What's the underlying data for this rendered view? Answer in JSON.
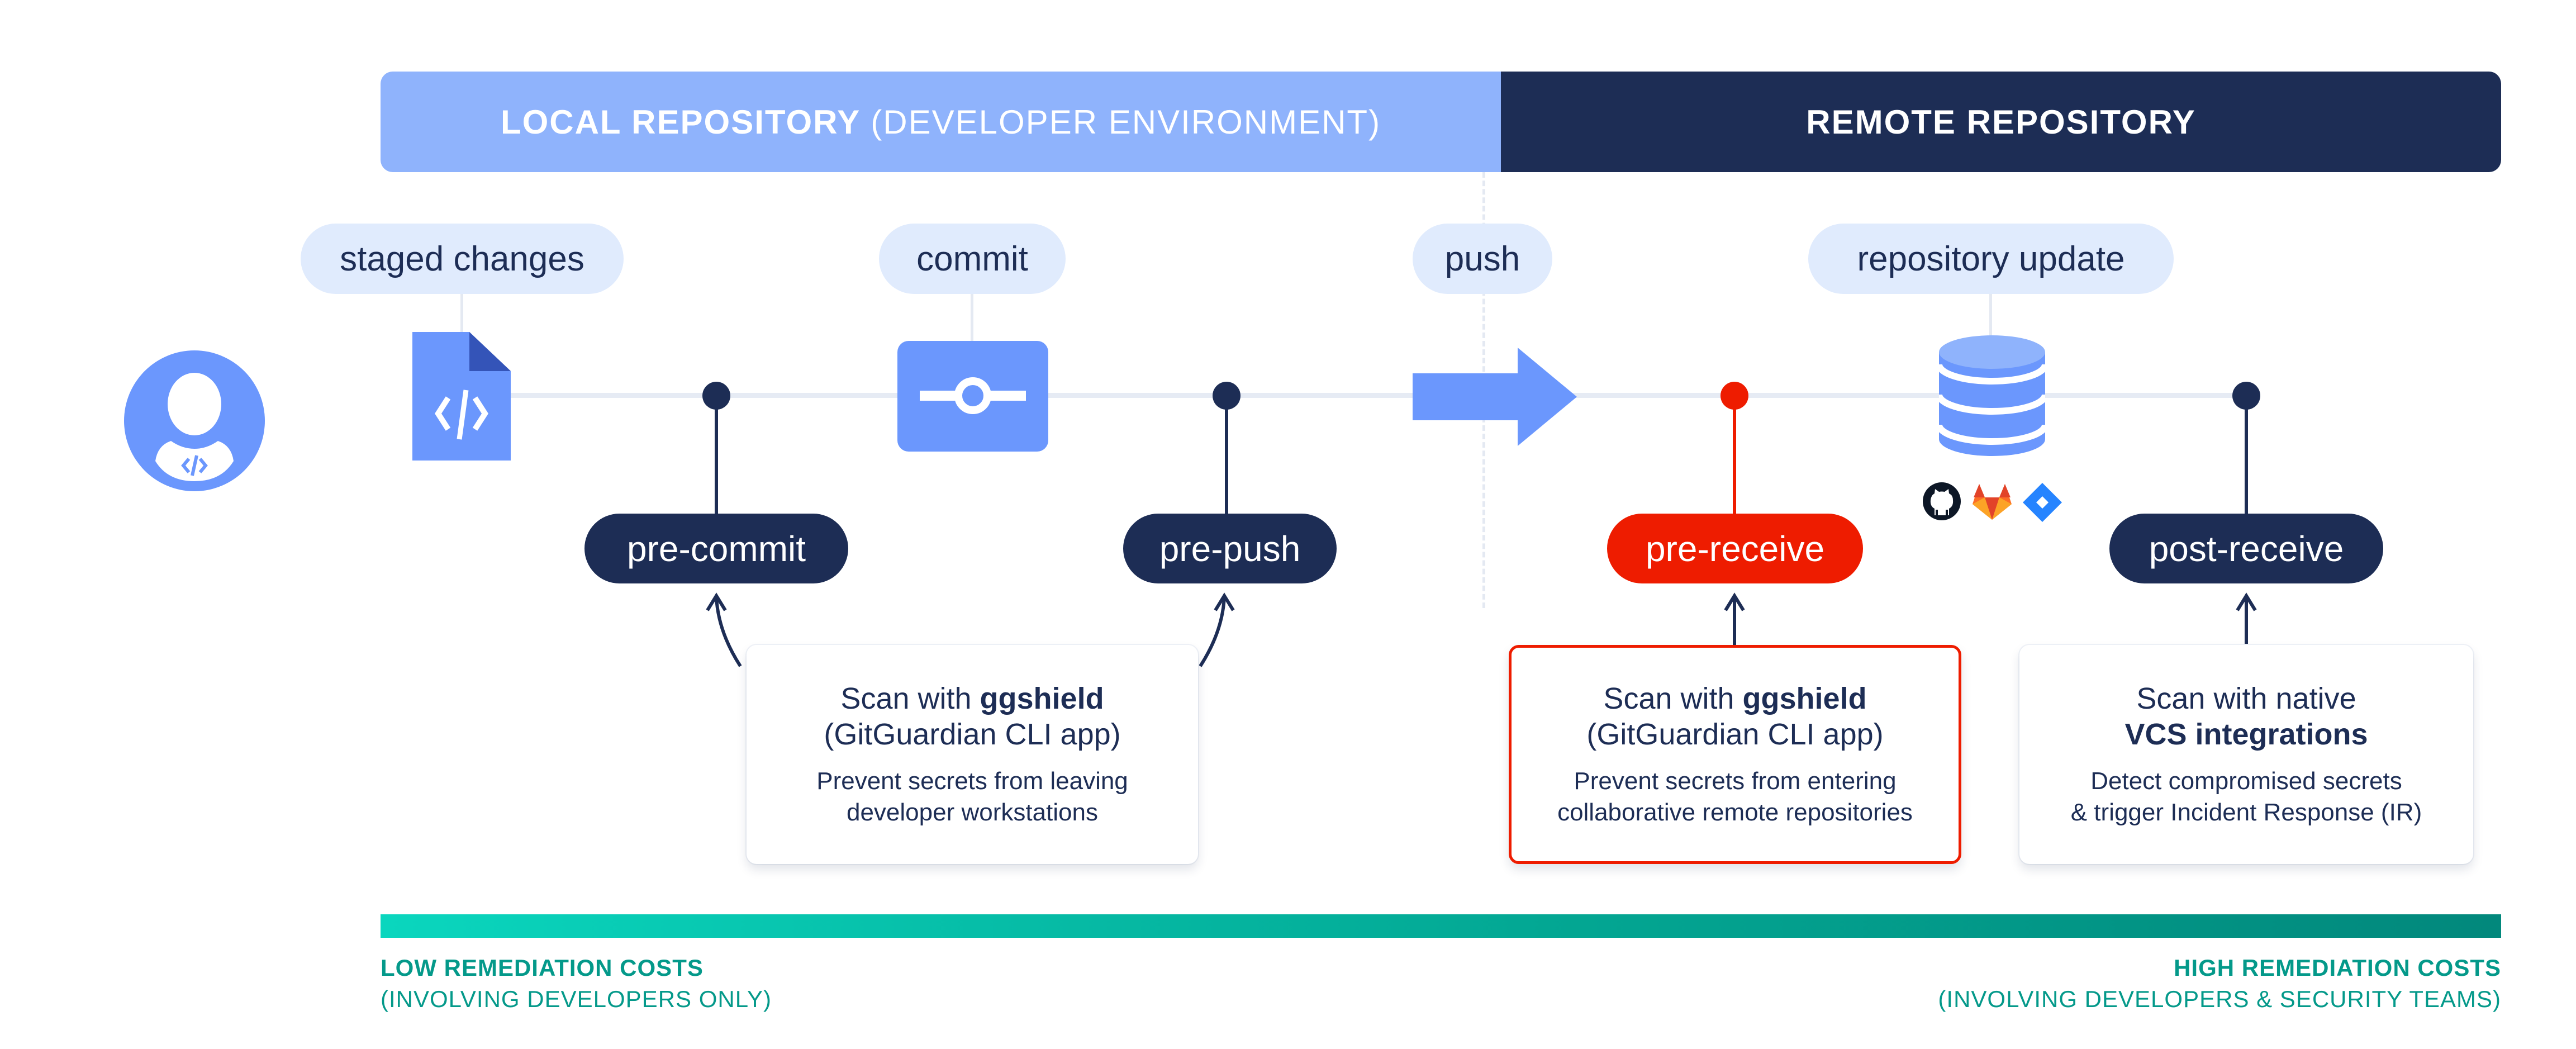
{
  "header": {
    "local_bold": "LOCAL REPOSITORY",
    "local_light": "(DEVELOPER ENVIRONMENT)",
    "remote": "REMOTE REPOSITORY"
  },
  "stages": [
    {
      "label": "staged changes",
      "icon": "code-file-icon"
    },
    {
      "label": "commit",
      "icon": "git-commit-icon"
    },
    {
      "label": "push",
      "icon": "arrow-right-icon"
    },
    {
      "label": "repository update",
      "icon": "database-icon"
    }
  ],
  "actor": {
    "icon": "developer-avatar-icon"
  },
  "vcs_icons": [
    "github-icon",
    "gitlab-icon",
    "jira-icon"
  ],
  "hooks": [
    {
      "label": "pre-commit",
      "color": "#1d2d55"
    },
    {
      "label": "pre-push",
      "color": "#1d2d55"
    },
    {
      "label": "pre-receive",
      "color": "#ee1c00"
    },
    {
      "label": "post-receive",
      "color": "#1d2d55"
    }
  ],
  "cards": [
    {
      "line1_prefix": "Scan with ",
      "line1_bold": "ggshield",
      "line2": "(GitGuardian CLI app)",
      "line2_bold": "",
      "desc1": "Prevent secrets from leaving",
      "desc2": "developer workstations"
    },
    {
      "line1_prefix": "Scan with ",
      "line1_bold": "ggshield",
      "line2": "(GitGuardian CLI app)",
      "line2_bold": "",
      "desc1": "Prevent secrets from entering",
      "desc2": "collaborative remote repositories"
    },
    {
      "line1_prefix": "Scan with native",
      "line1_bold": "",
      "line2": "",
      "line2_bold": "VCS integrations",
      "desc1": "Detect compromised secrets",
      "desc2": "& trigger Incident Response (IR)"
    }
  ],
  "costs": {
    "low_title": "LOW REMEDIATION COSTS",
    "low_sub": "(INVOLVING DEVELOPERS ONLY)",
    "high_title": "HIGH REMEDIATION COSTS",
    "high_sub": "(INVOLVING DEVELOPERS & SECURITY TEAMS)"
  },
  "colors": {
    "navy": "#1d2d55",
    "light_blue": "#8fb3fc",
    "icon_blue": "#6b97fd",
    "red": "#ee1c00",
    "teal": "#04998a"
  }
}
